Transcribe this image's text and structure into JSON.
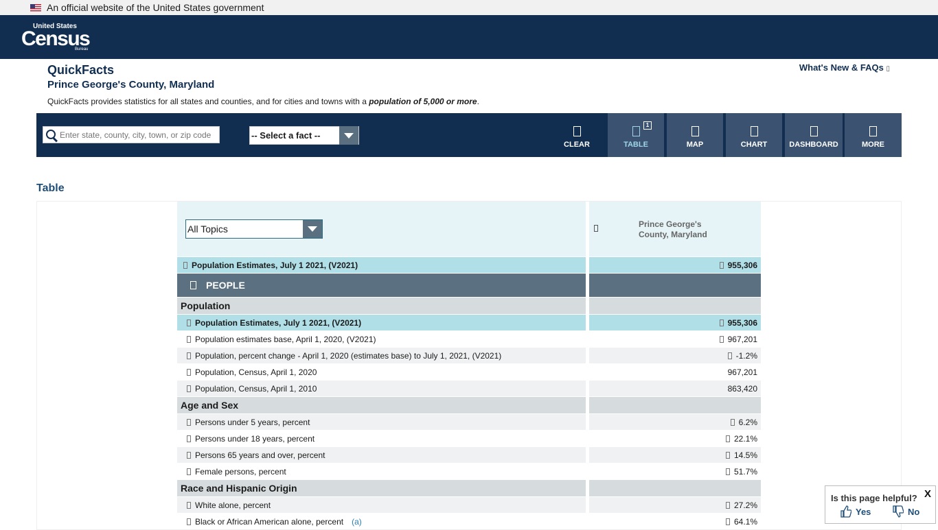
{
  "gov_banner": {
    "text": "An official website of the United States government"
  },
  "logo": {
    "line1": "United States",
    "line2": "Census",
    "line3": "Bureau"
  },
  "page": {
    "title": "QuickFacts",
    "subtitle": "Prince George's County, Maryland",
    "description_prefix": "QuickFacts provides statistics for all states and counties, and for cities and towns with a ",
    "description_em": "population of 5,000 or more",
    "description_suffix": ".",
    "whats_new": "What's New & FAQs"
  },
  "toolbar": {
    "search_placeholder": "Enter state, county, city, town, or zip code",
    "fact_select": "-- Select a fact --",
    "buttons": {
      "clear": "CLEAR",
      "table": "TABLE",
      "map": "MAP",
      "chart": "CHART",
      "dashboard": "DASHBOARD",
      "more": "MORE"
    },
    "table_badge": "1"
  },
  "section_title": "Table",
  "table": {
    "topic_select": "All Topics",
    "geo_header": "Prince George's County, Maryland",
    "top_row": {
      "label": "Population Estimates, July 1 2021, (V2021)",
      "value": "955,306"
    },
    "people_label": "PEOPLE",
    "cat_population": "Population",
    "population_rows": [
      {
        "label": "Population Estimates, July 1 2021, (V2021)",
        "value": "955,306"
      },
      {
        "label": "Population estimates base, April 1, 2020, (V2021)",
        "value": "967,201"
      },
      {
        "label": "Population, percent change - April 1, 2020 (estimates base) to July 1, 2021, (V2021)",
        "value": "-1.2%"
      },
      {
        "label": "Population, Census, April 1, 2020",
        "value": "967,201"
      },
      {
        "label": "Population, Census, April 1, 2010",
        "value": "863,420"
      }
    ],
    "cat_age": "Age and Sex",
    "age_rows": [
      {
        "label": "Persons under 5 years, percent",
        "value": "6.2%"
      },
      {
        "label": "Persons under 18 years, percent",
        "value": "22.1%"
      },
      {
        "label": "Persons 65 years and over, percent",
        "value": "14.5%"
      },
      {
        "label": "Female persons, percent",
        "value": "51.7%"
      }
    ],
    "cat_race": "Race and Hispanic Origin",
    "race_rows": [
      {
        "label": "White alone, percent",
        "value": "27.2%"
      },
      {
        "label": "Black or African American alone, percent",
        "value": "64.1%",
        "footnote": "(a)"
      }
    ]
  },
  "helpful": {
    "question": "Is this page helpful?",
    "yes": "Yes",
    "no": "No",
    "close": "X"
  }
}
